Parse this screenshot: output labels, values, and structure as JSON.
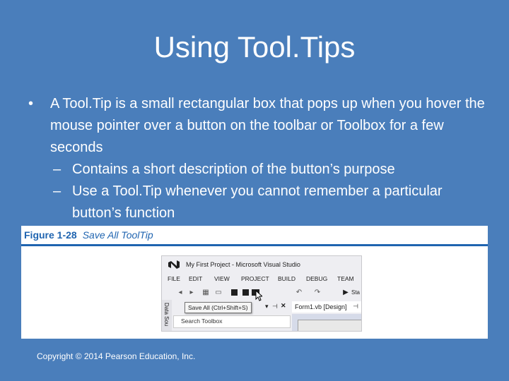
{
  "slide": {
    "title": "Using Tool.Tips",
    "bullet_marker": "•",
    "sub_marker": "–",
    "bullets": [
      {
        "text": "A Tool.Tip is a small rectangular box that pops up when you hover the mouse pointer over a button on the toolbar or Toolbox for a few seconds",
        "subs": [
          "Contains a short description of the button’s purpose",
          "Use a Tool.Tip whenever you cannot remember a particular button’s function"
        ]
      }
    ],
    "copyright": "Copyright © 2014 Pearson Education, Inc."
  },
  "figure": {
    "number": "Figure 1-28",
    "name": "Save All ToolTip",
    "accent_color": "#1f64b0"
  },
  "vs": {
    "window_title": "My First Project - Microsoft Visual Studio",
    "menu": [
      "FILE",
      "EDIT",
      "VIEW",
      "PROJECT",
      "BUILD",
      "DEBUG",
      "TEAM"
    ],
    "toolbar_overflow_label": "Sta",
    "side_tab_label": "Data Sou",
    "toolbox_search_placeholder": "Search Toolbox",
    "tooltip_text": "Save All (Ctrl+Shift+S)",
    "doc_tab_label": "Form1.vb [Design]",
    "icons": [
      "visual-studio-logo",
      "back",
      "forward",
      "new-project",
      "open-file",
      "save",
      "save-all",
      "undo",
      "redo",
      "start"
    ]
  },
  "colors": {
    "slide_background": "#4a7ebb",
    "text": "#ffffff",
    "vs_logo": "#68217a"
  }
}
